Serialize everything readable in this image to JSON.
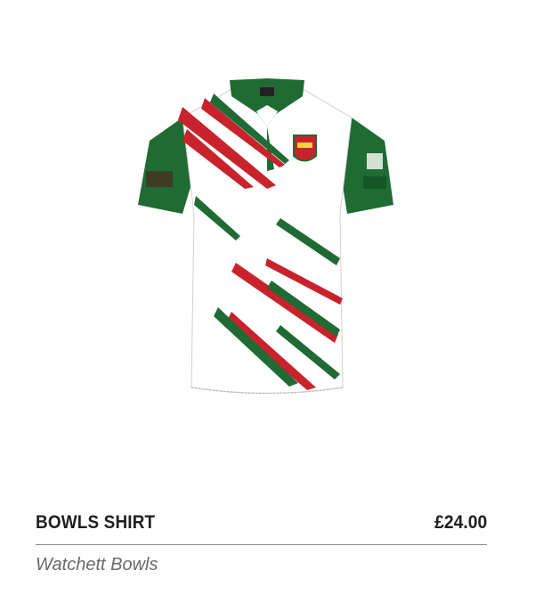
{
  "product": {
    "name": "BOWLS SHIRT",
    "price": "£24.00",
    "club": "Watchett Bowls",
    "image_icon": "polo-shirt-image",
    "colors": {
      "green": "#1f6b33",
      "red": "#c8232c",
      "white": "#ffffff"
    }
  }
}
